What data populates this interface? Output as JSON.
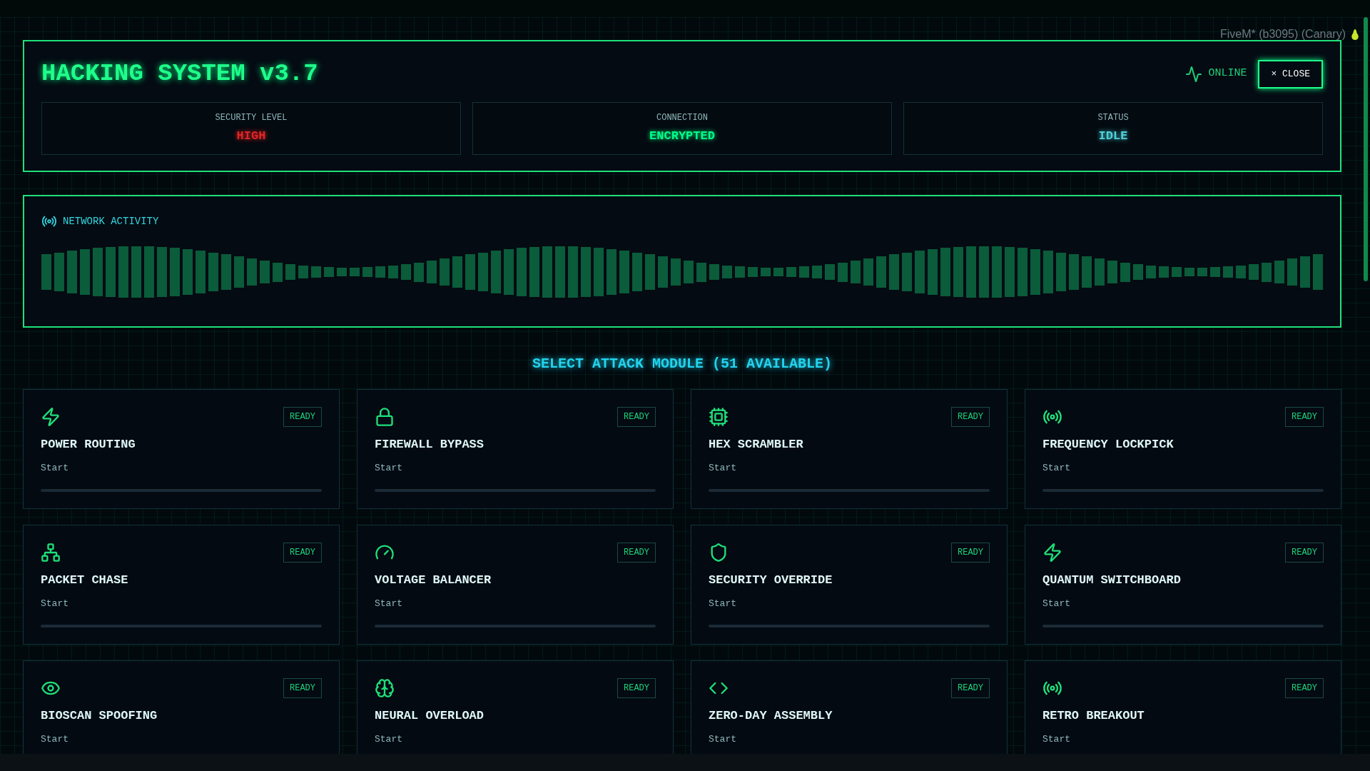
{
  "overlay": {
    "text": "FiveM* (b3095) (Canary)"
  },
  "header": {
    "title": "HACKING SYSTEM v3.7",
    "status": "ONLINE",
    "close_button": "× CLOSE",
    "stats": [
      {
        "label": "SECURITY LEVEL",
        "value": "HIGH",
        "color": "#e02424"
      },
      {
        "label": "CONNECTION",
        "value": "ENCRYPTED",
        "color": "#00ff88"
      },
      {
        "label": "STATUS",
        "value": "IDLE",
        "color": "#4fd1d9"
      }
    ]
  },
  "network": {
    "title": "NETWORK ACTIVITY"
  },
  "modules": {
    "heading": "SELECT ATTACK MODULE (51 AVAILABLE)",
    "cards": [
      {
        "title": "POWER ROUTING",
        "badge": "READY",
        "action": "Start",
        "level": 0
      },
      {
        "title": "FIREWALL BYPASS",
        "badge": "READY",
        "action": "Start",
        "level": 0
      },
      {
        "title": "HEX SCRAMBLER",
        "badge": "READY",
        "action": "Start",
        "level": 0
      },
      {
        "title": "FREQUENCY LOCKPICK",
        "badge": "READY",
        "action": "Start",
        "level": 0
      },
      {
        "title": "PACKET CHASE",
        "badge": "READY",
        "action": "Start",
        "level": 0
      },
      {
        "title": "VOLTAGE BALANCER",
        "badge": "READY",
        "action": "Start",
        "level": 0
      },
      {
        "title": "SECURITY OVERRIDE",
        "badge": "READY",
        "action": "Start",
        "level": 0
      },
      {
        "title": "QUANTUM SWITCHBOARD",
        "badge": "READY",
        "action": "Start",
        "level": 0
      },
      {
        "title": "BIOSCAN SPOOFING",
        "badge": "READY",
        "action": "Start"
      },
      {
        "title": "NEURAL OVERLOAD",
        "badge": "READY",
        "action": "Start"
      },
      {
        "title": "ZERO-DAY ASSEMBLY",
        "badge": "READY",
        "action": "Start"
      },
      {
        "title": "RETRO BREAKOUT",
        "badge": "READY",
        "action": "Start"
      }
    ]
  }
}
